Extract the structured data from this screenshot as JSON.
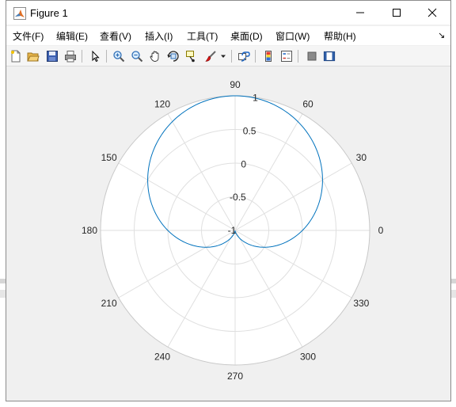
{
  "window": {
    "title": "Figure 1",
    "controls": {
      "minimize": "minimize",
      "maximize": "maximize",
      "close": "close"
    }
  },
  "menu": {
    "items": [
      {
        "label": "文件(F)"
      },
      {
        "label": "编辑(E)"
      },
      {
        "label": "查看(V)"
      },
      {
        "label": "插入(I)"
      },
      {
        "label": "工具(T)"
      },
      {
        "label": "桌面(D)"
      },
      {
        "label": "窗口(W)"
      },
      {
        "label": "帮助(H)"
      }
    ],
    "overflow_glyph": "↘"
  },
  "toolbar": {
    "buttons": [
      {
        "name": "new-figure-icon"
      },
      {
        "name": "open-file-icon"
      },
      {
        "name": "save-icon"
      },
      {
        "name": "print-icon"
      },
      {
        "name": "edit-plot-arrow-icon"
      },
      {
        "name": "zoom-in-icon"
      },
      {
        "name": "zoom-out-icon"
      },
      {
        "name": "pan-hand-icon"
      },
      {
        "name": "rotate-3d-icon"
      },
      {
        "name": "data-cursor-icon"
      },
      {
        "name": "brush-icon"
      },
      {
        "name": "link-plot-icon"
      },
      {
        "name": "insert-colorbar-icon"
      },
      {
        "name": "insert-legend-icon"
      },
      {
        "name": "hide-plot-tools-icon"
      },
      {
        "name": "show-plot-tools-icon"
      }
    ]
  },
  "chart_data": {
    "type": "line",
    "coordinate_system": "polar",
    "theta_ticks_deg": [
      "0",
      "30",
      "60",
      "90",
      "120",
      "150",
      "180",
      "210",
      "240",
      "270",
      "300",
      "330"
    ],
    "r_ticks": [
      "-1",
      "-0.5",
      "0",
      "0.5",
      "1"
    ],
    "r_lim": [
      -1,
      1
    ],
    "theta_unit": "degrees",
    "series": [
      {
        "equation": "r = sin(theta)",
        "theta_range_deg": [
          0,
          360
        ],
        "color": "#0072bd"
      }
    ],
    "grid": true,
    "title": "",
    "legend": "none"
  },
  "colors": {
    "line": "#0072bd",
    "grid": "#dfdfdf",
    "axis_bg": "#ffffff",
    "figure_bg": "#f0f0f0",
    "outer_circle": "#c8c8c8"
  }
}
